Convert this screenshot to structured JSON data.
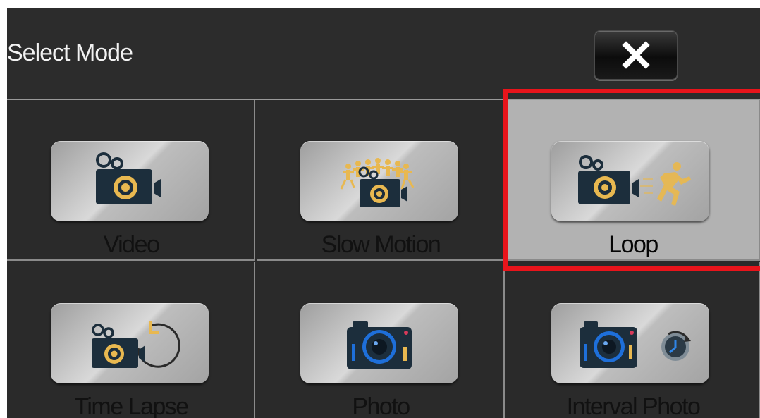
{
  "header": {
    "title": "Select Mode"
  },
  "close_button": {
    "icon": "close-icon"
  },
  "modes": [
    {
      "id": "video",
      "label": "Video",
      "icon": "video-camera-icon",
      "selected": false
    },
    {
      "id": "slow-motion",
      "label": "Slow Motion",
      "icon": "slow-motion-icon",
      "selected": false
    },
    {
      "id": "loop",
      "label": "Loop",
      "icon": "loop-recording-icon",
      "selected": true
    },
    {
      "id": "time-lapse",
      "label": "Time Lapse",
      "icon": "time-lapse-icon",
      "selected": false
    },
    {
      "id": "photo",
      "label": "Photo",
      "icon": "photo-camera-icon",
      "selected": false
    },
    {
      "id": "interval-photo",
      "label": "Interval Photo",
      "icon": "interval-photo-icon",
      "selected": false
    }
  ],
  "colors": {
    "background": "#2a2a2a",
    "selected_cell": "#b2b2b2",
    "highlight": "#e8141b",
    "accent_gold": "#e8b850",
    "camera_body": "#1c2e3c",
    "lens_blue": "#1e6fd9"
  }
}
